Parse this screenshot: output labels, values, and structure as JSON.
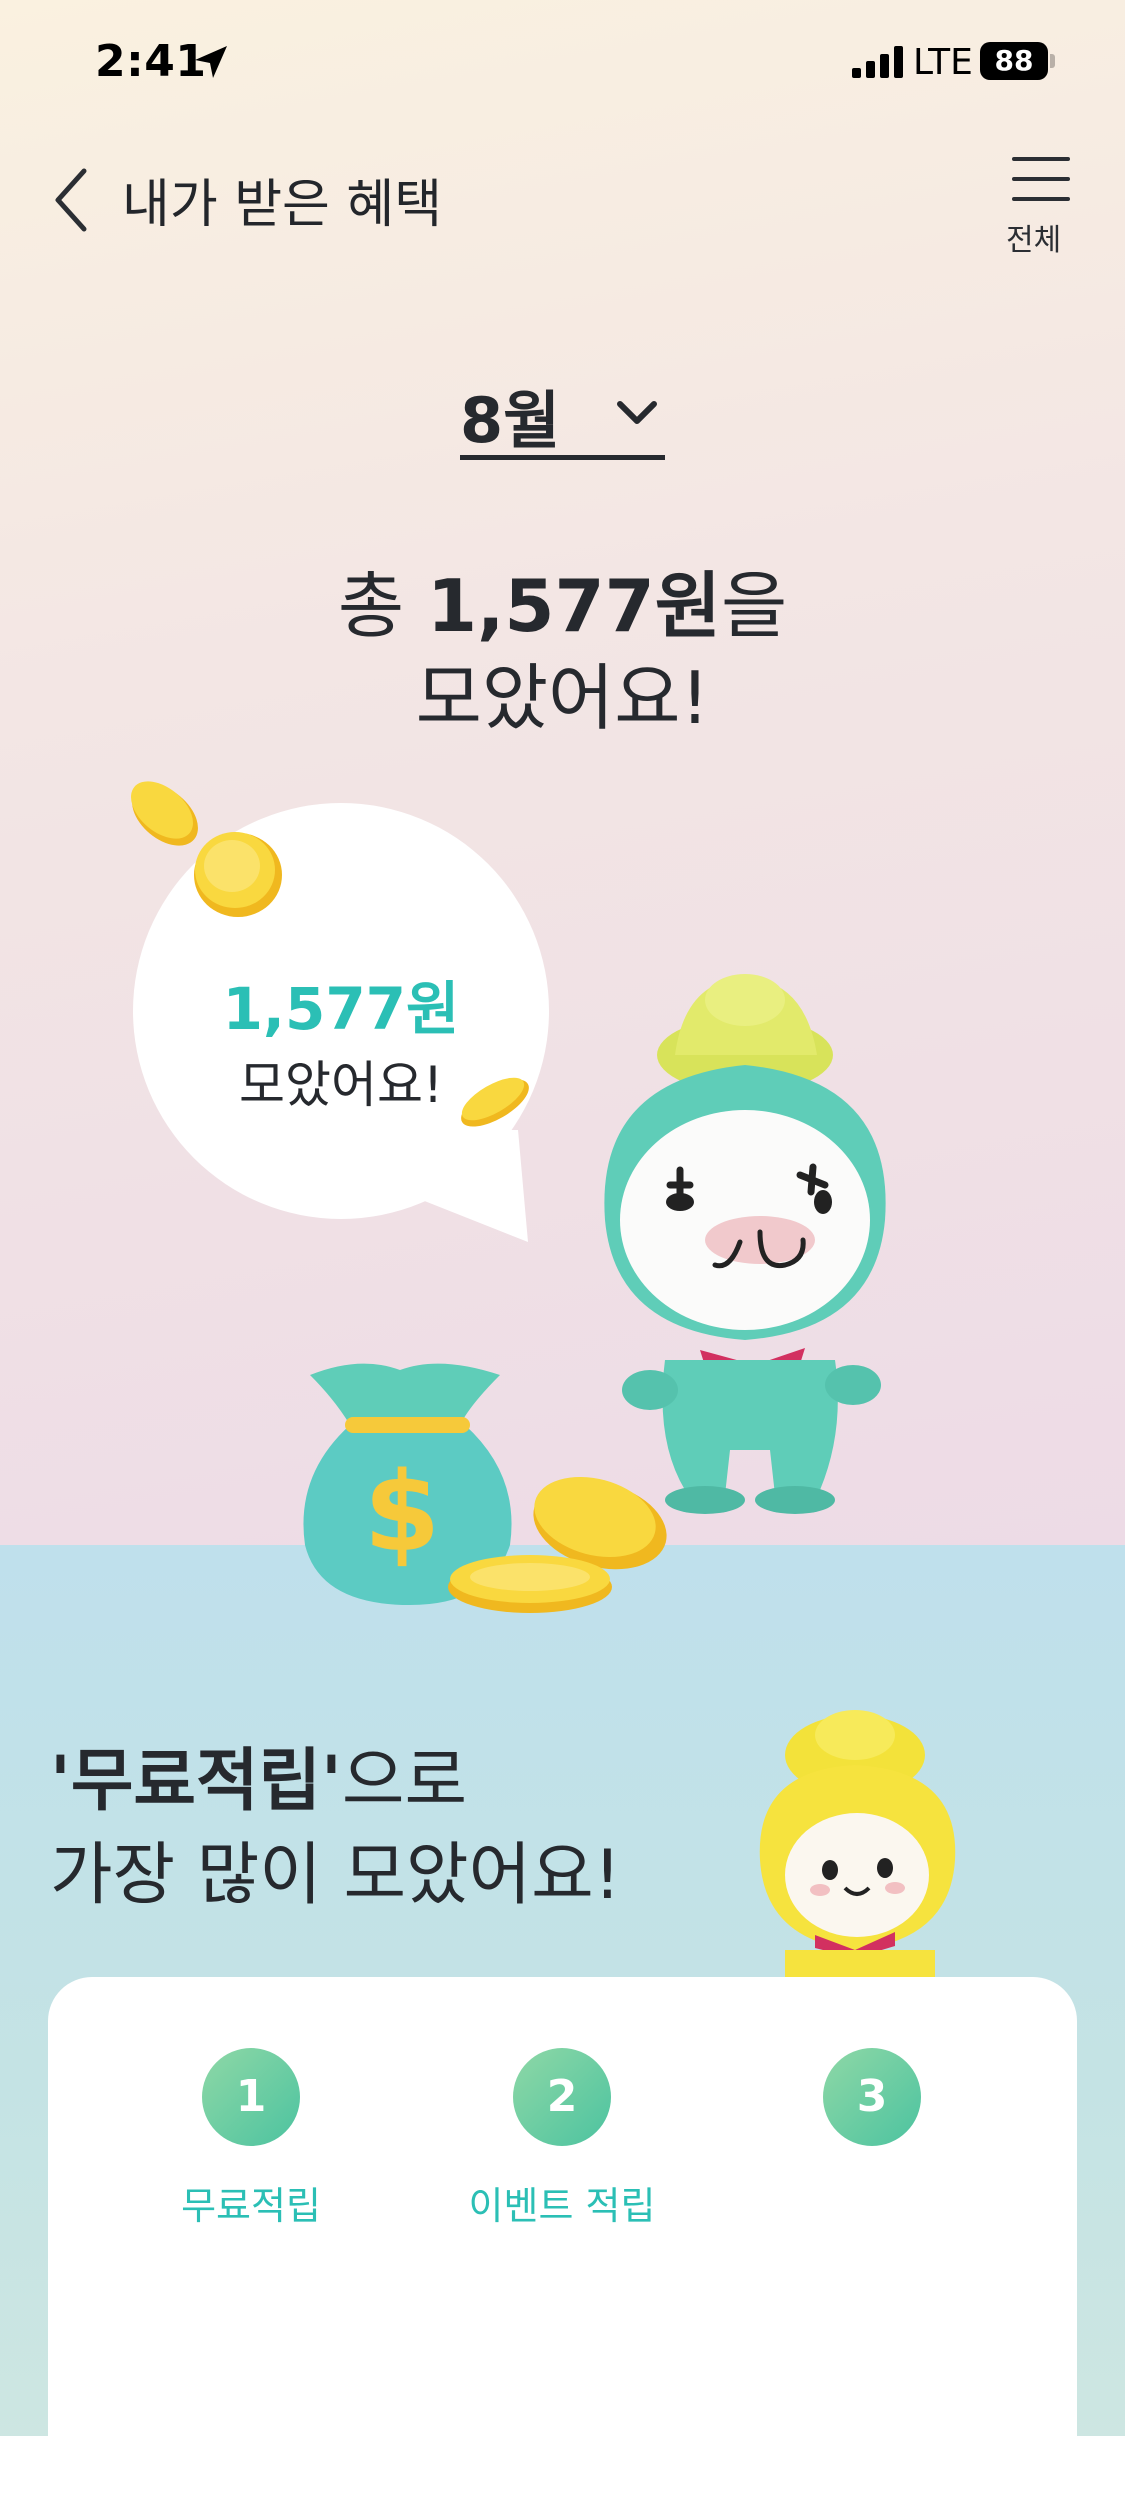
{
  "status_bar": {
    "time": "2:41",
    "network": "LTE",
    "battery": "88"
  },
  "nav": {
    "title": "내가 받은 혜택",
    "menu_label": "전체"
  },
  "month_selector": {
    "value": "8월"
  },
  "summary": {
    "prefix": "총 ",
    "amount": "1,577원",
    "suffix": "을",
    "line2": "모았어요!"
  },
  "bubble": {
    "amount": "1,577원",
    "text": "모았어요!"
  },
  "top_source": {
    "highlight": "'무료적립'",
    "line1_suffix": "으로",
    "line2": "가장 많이 모았어요!"
  },
  "ranking": [
    {
      "rank": "1",
      "label": "무료적립"
    },
    {
      "rank": "2",
      "label": "이벤트 적립"
    },
    {
      "rank": "3",
      "label": ""
    }
  ],
  "colors": {
    "accent": "#2bbfb5",
    "mint": "#5fcdb8",
    "coin": "#f7cf35"
  }
}
